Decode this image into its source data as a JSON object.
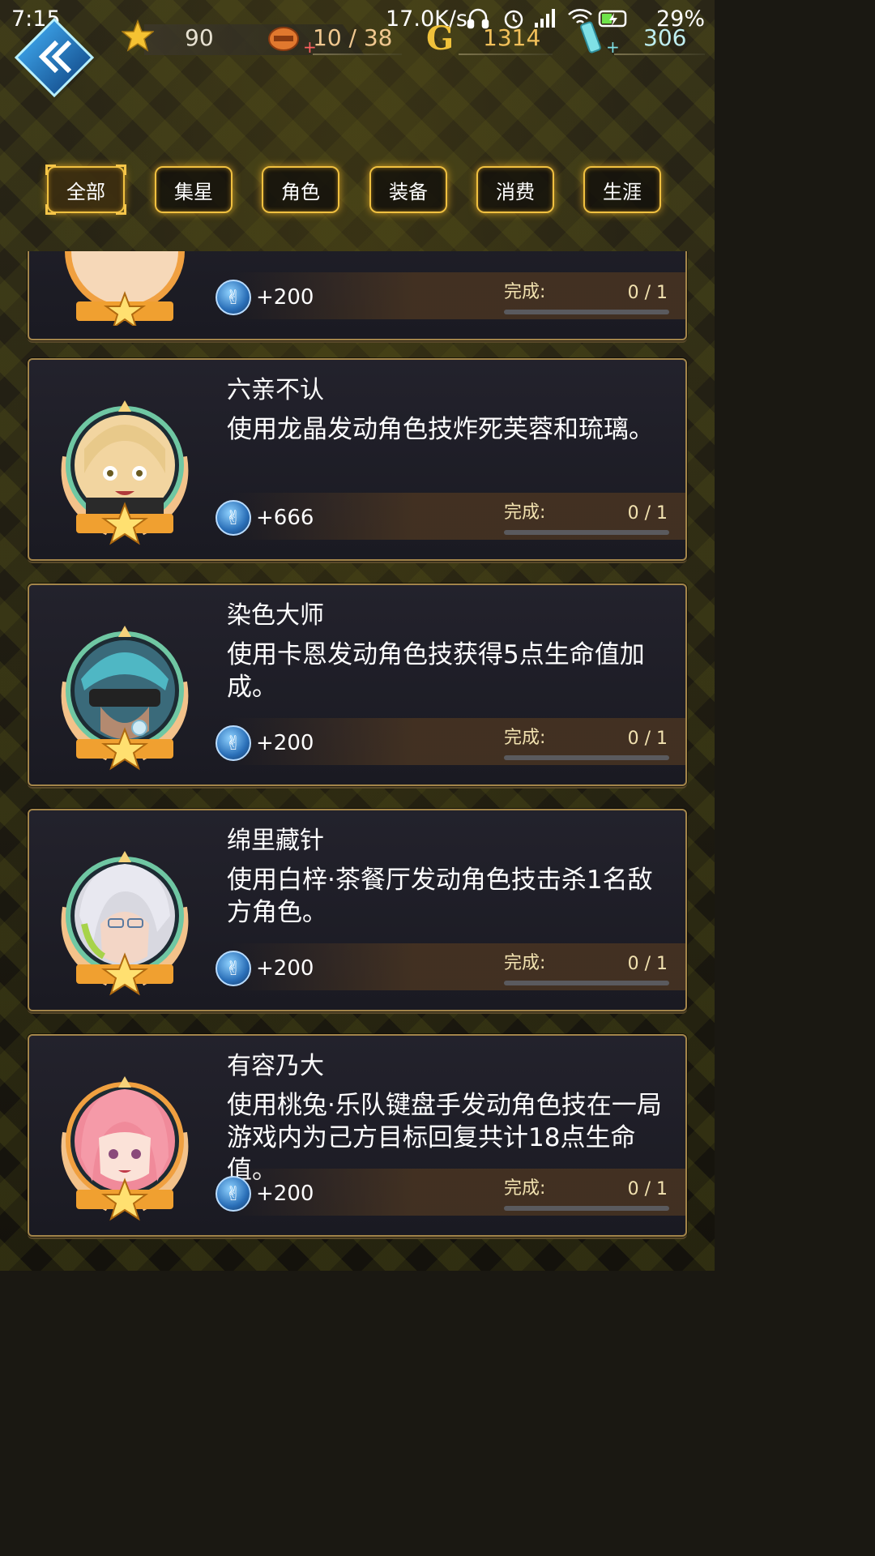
{
  "status_bar": {
    "time": "7:15",
    "speed": "17.0K/s",
    "battery": "29%"
  },
  "resources": {
    "stars": "90",
    "stamina": "10 / 38",
    "gold": "1314",
    "gems": "306",
    "gold_letter": "G",
    "plus": "+"
  },
  "tabs": [
    {
      "label": "全部",
      "active": true
    },
    {
      "label": "集星",
      "active": false
    },
    {
      "label": "角色",
      "active": false
    },
    {
      "label": "装备",
      "active": false
    },
    {
      "label": "消费",
      "active": false
    },
    {
      "label": "生涯",
      "active": false
    }
  ],
  "achievements": [
    {
      "title": "",
      "desc": "",
      "reward": "+200",
      "done_label": "完成:",
      "progress": "0 / 1",
      "progress_fraction": 0,
      "avatar": "partial-character"
    },
    {
      "title": "六亲不认",
      "desc": "使用龙晶发动角色技炸死芙蓉和琉璃。",
      "reward": "+666",
      "done_label": "完成:",
      "progress": "0 / 1",
      "progress_fraction": 0,
      "avatar": "blonde-girl"
    },
    {
      "title": "染色大师",
      "desc": "使用卡恩发动角色技获得5点生命值加成。",
      "reward": "+200",
      "done_label": "完成:",
      "progress": "0 / 1",
      "progress_fraction": 0,
      "avatar": "teal-hair-masked"
    },
    {
      "title": "绵里藏针",
      "desc": "使用白梓·茶餐厅发动角色技击杀1名敌方角色。",
      "reward": "+200",
      "done_label": "完成:",
      "progress": "0 / 1",
      "progress_fraction": 0,
      "avatar": "silver-hair-glasses"
    },
    {
      "title": "有容乃大",
      "desc": "使用桃兔·乐队键盘手发动角色技在一局游戏内为己方目标回复共计18点生命值。",
      "reward": "+200",
      "done_label": "完成:",
      "progress": "0 / 1",
      "progress_fraction": 0,
      "avatar": "pink-hair-girl"
    }
  ],
  "colors": {
    "accent_gold": "#f0c040",
    "card_border": "#a3854a",
    "progress_text": "#f2e2b0"
  },
  "icons": {
    "back": "double-chevron-left-icon",
    "star": "star-icon",
    "stamina": "stamina-icon",
    "gold": "gold-coin-icon",
    "gem": "crystal-icon",
    "reward": "reward-token-icon"
  }
}
